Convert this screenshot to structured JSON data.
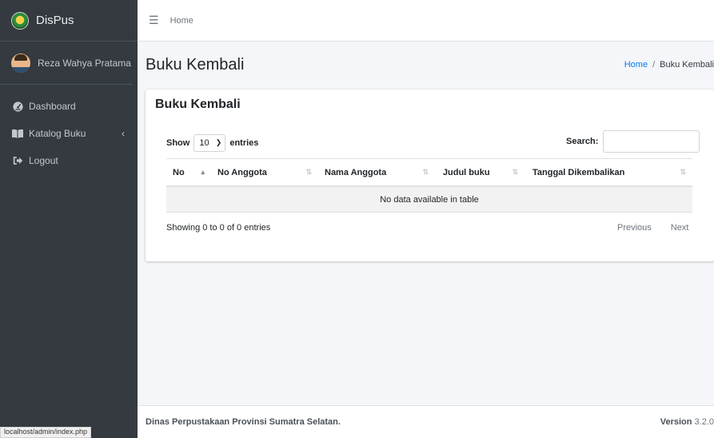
{
  "brand": {
    "name": "DisPus"
  },
  "user": {
    "name": "Reza Wahya Pratama"
  },
  "sidebar": {
    "items": [
      {
        "label": "Dashboard",
        "icon": "tachometer-icon"
      },
      {
        "label": "Katalog Buku",
        "icon": "book-icon",
        "chevron": "‹"
      },
      {
        "label": "Logout",
        "icon": "sign-out-icon"
      }
    ]
  },
  "topbar": {
    "home_link": "Home"
  },
  "header": {
    "title": "Buku Kembali"
  },
  "breadcrumb": {
    "home": "Home",
    "separator": "/",
    "active": "Buku Kembali"
  },
  "card": {
    "title": "Buku Kembali",
    "length": {
      "show_label": "Show",
      "value": "10",
      "entries_label": "entries"
    },
    "search": {
      "label": "Search:",
      "value": ""
    },
    "table": {
      "columns": [
        "No",
        "No Anggota",
        "Nama Anggota",
        "Judul buku",
        "Tanggal Dikembalikan"
      ],
      "empty_message": "No data available in table"
    },
    "info": "Showing 0 to 0 of 0 entries",
    "pagination": {
      "previous": "Previous",
      "next": "Next"
    }
  },
  "footer": {
    "text": "Dinas Perpustakaan Provinsi Sumatra Selatan.",
    "version_label": "Version",
    "version": "3.2.0"
  },
  "status_bar": {
    "url": "localhost/admin/index.php"
  }
}
